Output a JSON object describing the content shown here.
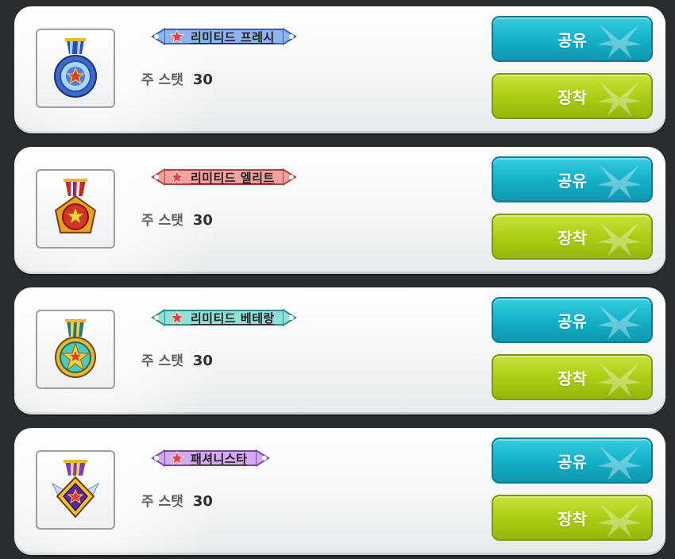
{
  "medals": [
    {
      "name": "리미티드 프레시",
      "stat_label": "주 스탯",
      "stat_value": "30",
      "share_label": "공유",
      "equip_label": "장착",
      "icon": "blue-medal-icon",
      "banner_color": "#8fb4f0",
      "banner_border": "#3d5fa8"
    },
    {
      "name": "리미티드 엘리트",
      "stat_label": "주 스탯",
      "stat_value": "30",
      "share_label": "공유",
      "equip_label": "장착",
      "icon": "red-medal-icon",
      "banner_color": "#f4a0a0",
      "banner_border": "#a8443d"
    },
    {
      "name": "리미티드 베테랑",
      "stat_label": "주 스탯",
      "stat_value": "30",
      "share_label": "공유",
      "equip_label": "장착",
      "icon": "teal-medal-icon",
      "banner_color": "#8fe0d8",
      "banner_border": "#2f8a80"
    },
    {
      "name": "패셔니스타",
      "stat_label": "주 스탯",
      "stat_value": "30",
      "share_label": "공유",
      "equip_label": "장착",
      "icon": "purple-medal-icon",
      "banner_color": "#d4a8f2",
      "banner_border": "#7a45a8"
    }
  ],
  "colors": {
    "share_button": "#13afc8",
    "equip_button": "#a9cc12",
    "background": "#2a2d30"
  }
}
